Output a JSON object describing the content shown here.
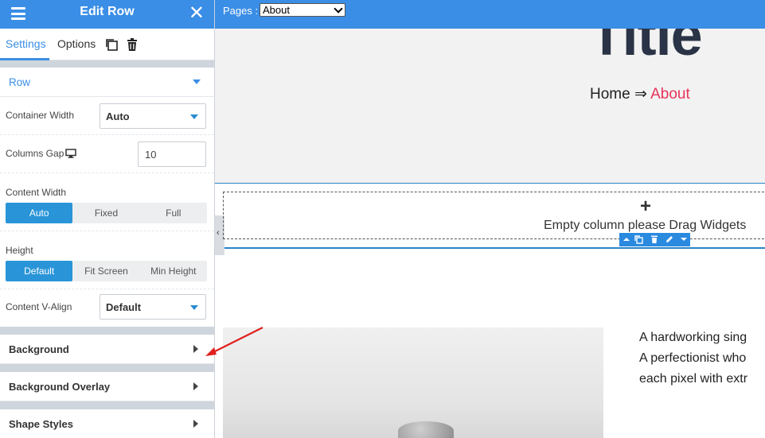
{
  "panel": {
    "title": "Edit Row",
    "tabs": [
      {
        "label": "Settings",
        "active": true
      },
      {
        "label": "Options",
        "active": false
      }
    ],
    "row_section": {
      "label": "Row"
    },
    "fields": {
      "container_width": {
        "label": "Container Width",
        "value": "Auto"
      },
      "columns_gap": {
        "label": "Columns Gap",
        "value": "10"
      },
      "content_width": {
        "label": "Content Width",
        "options": [
          "Auto",
          "Fixed",
          "Full"
        ],
        "selected": "Auto"
      },
      "height": {
        "label": "Height",
        "options": [
          "Default",
          "Fit Screen",
          "Min Height"
        ],
        "selected": "Default"
      },
      "content_valign": {
        "label": "Content V-Align",
        "value": "Default"
      }
    },
    "collapsed_sections": [
      {
        "label": "Background"
      },
      {
        "label": "Background Overlay"
      },
      {
        "label": "Shape Styles"
      }
    ],
    "colors": {
      "header": "#3a8ee6",
      "accent": "#2995d8"
    }
  },
  "topbar": {
    "pages_label": "Pages :",
    "pages_selected": "About"
  },
  "hero": {
    "title": "Title",
    "breadcrumb_home": "Home",
    "breadcrumb_sep": "⇒",
    "breadcrumb_current": "About"
  },
  "empty_column": {
    "plus": "+",
    "message": "Empty column please Drag Widgets"
  },
  "content": {
    "bio_lines": [
      "A hardworking sing",
      "A perfectionist who",
      "each pixel with extr"
    ]
  }
}
